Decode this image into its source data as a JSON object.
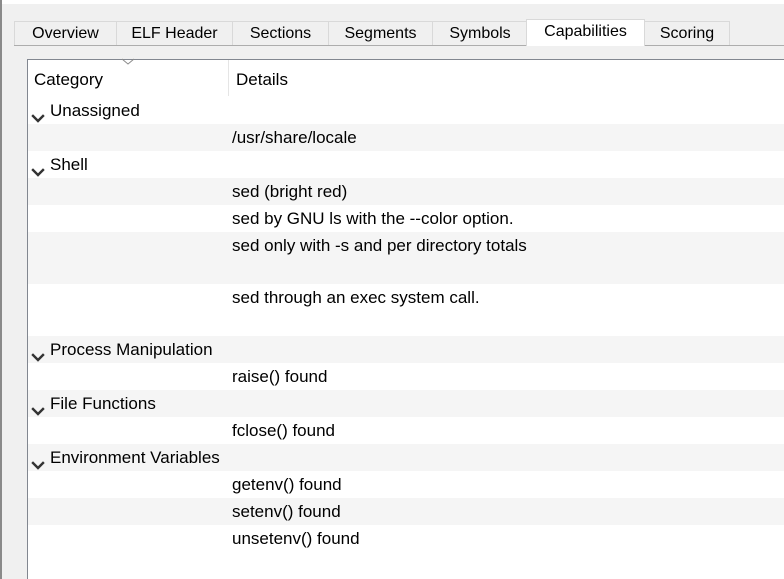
{
  "tabs": [
    {
      "label": "Overview",
      "active": false
    },
    {
      "label": "ELF Header",
      "active": false
    },
    {
      "label": "Sections",
      "active": false
    },
    {
      "label": "Segments",
      "active": false
    },
    {
      "label": "Symbols",
      "active": false
    },
    {
      "label": "Capabilities",
      "active": true
    },
    {
      "label": "Scoring",
      "active": false
    }
  ],
  "tree": {
    "columns": {
      "category": "Category",
      "details": "Details"
    },
    "sort_indicator": "chevron-down-icon",
    "rows": [
      {
        "type": "group",
        "category": "Unassigned",
        "details": "",
        "expanded": true
      },
      {
        "type": "item",
        "category": "",
        "details": "/usr/share/locale"
      },
      {
        "type": "group",
        "category": "Shell",
        "details": "",
        "expanded": true
      },
      {
        "type": "item",
        "category": "",
        "details": "sed (bright red)"
      },
      {
        "type": "item",
        "category": "",
        "details": "sed by GNU ls with the --color option."
      },
      {
        "type": "item",
        "category": "",
        "details": "sed only with -s and per directory totals",
        "tall": true
      },
      {
        "type": "item",
        "category": "",
        "details": "sed through an exec system call.",
        "tall": true
      },
      {
        "type": "group",
        "category": "Process Manipulation",
        "details": "",
        "expanded": true
      },
      {
        "type": "item",
        "category": "",
        "details": "raise() found"
      },
      {
        "type": "group",
        "category": "File Functions",
        "details": "",
        "expanded": true
      },
      {
        "type": "item",
        "category": "",
        "details": "fclose() found"
      },
      {
        "type": "group",
        "category": "Environment Variables",
        "details": "",
        "expanded": true
      },
      {
        "type": "item",
        "category": "",
        "details": "getenv() found"
      },
      {
        "type": "item",
        "category": "",
        "details": "setenv() found"
      },
      {
        "type": "item",
        "category": "",
        "details": "unsetenv() found"
      }
    ]
  }
}
